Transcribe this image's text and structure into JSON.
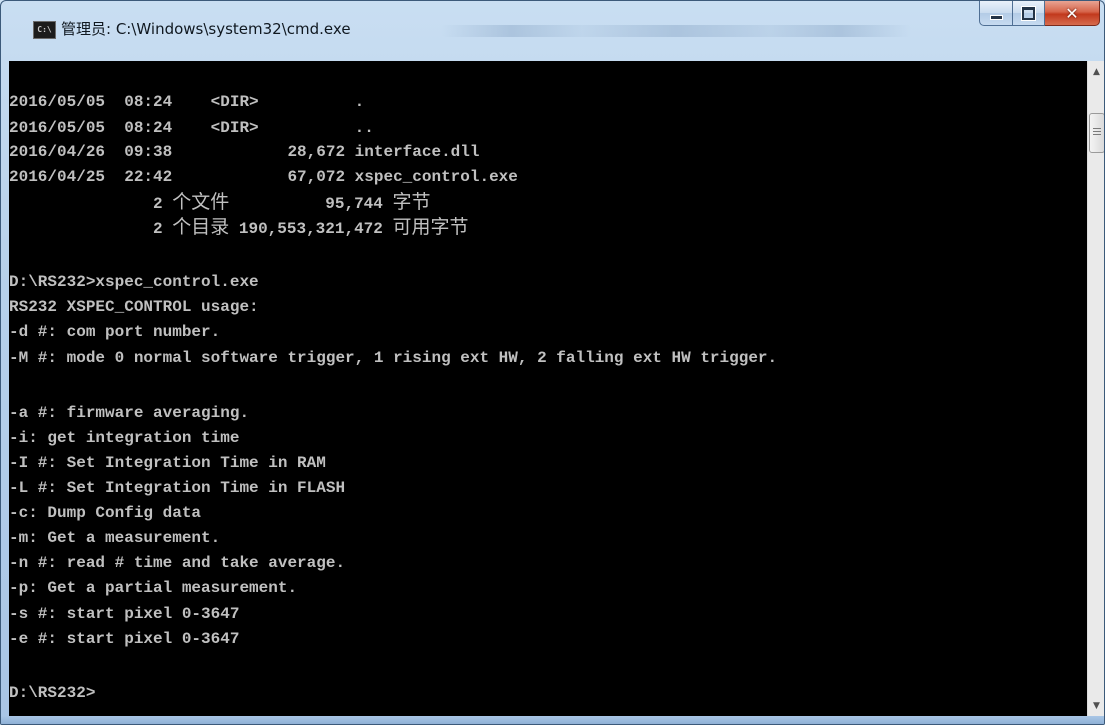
{
  "window": {
    "title": "管理员: C:\\Windows\\system32\\cmd.exe",
    "icon": "cmd-icon",
    "buttons": {
      "minimize": "minimize-icon",
      "maximize": "maximize-icon",
      "close": "close-icon"
    },
    "close_glyph": "✕"
  },
  "console": {
    "lines": [
      "",
      "2016/05/05  08:24    <DIR>          .",
      "2016/05/05  08:24    <DIR>          ..",
      "2016/04/26  09:38            28,672 interface.dll",
      "2016/04/25  22:42            67,072 xspec_control.exe",
      "               2 ",
      "               2 ",
      "",
      "D:\\RS232>xspec_control.exe",
      "RS232 XSPEC_CONTROL usage:",
      "-d #: com port number.",
      "-M #: mode 0 normal software trigger, 1 rising ext HW, 2 falling ext HW trigger.",
      "",
      "-a #: firmware averaging.",
      "-i: get integration time",
      "-I #: Set Integration Time in RAM",
      "-L #: Set Integration Time in FLASH",
      "-c: Dump Config data",
      "-m: Get a measurement.",
      "-n #: read # time and take average.",
      "-p: Get a partial measurement.",
      "-s #: start pixel 0-3647",
      "-e #: start pixel 0-3647",
      "",
      "D:\\RS232>"
    ],
    "summary_files": {
      "label": "个文件",
      "size": "95,744",
      "unit": "字节"
    },
    "summary_dirs": {
      "label": "个目录",
      "size": "190,553,321,472",
      "unit": "可用字节"
    }
  },
  "scrollbar": {
    "up": "scroll-up-arrow-icon",
    "down": "scroll-down-arrow-icon",
    "up_glyph": "▲",
    "down_glyph": "▼"
  },
  "colors": {
    "console_bg": "#000000",
    "console_fg": "#c0c0c0",
    "close_button": "#c94a2e"
  }
}
